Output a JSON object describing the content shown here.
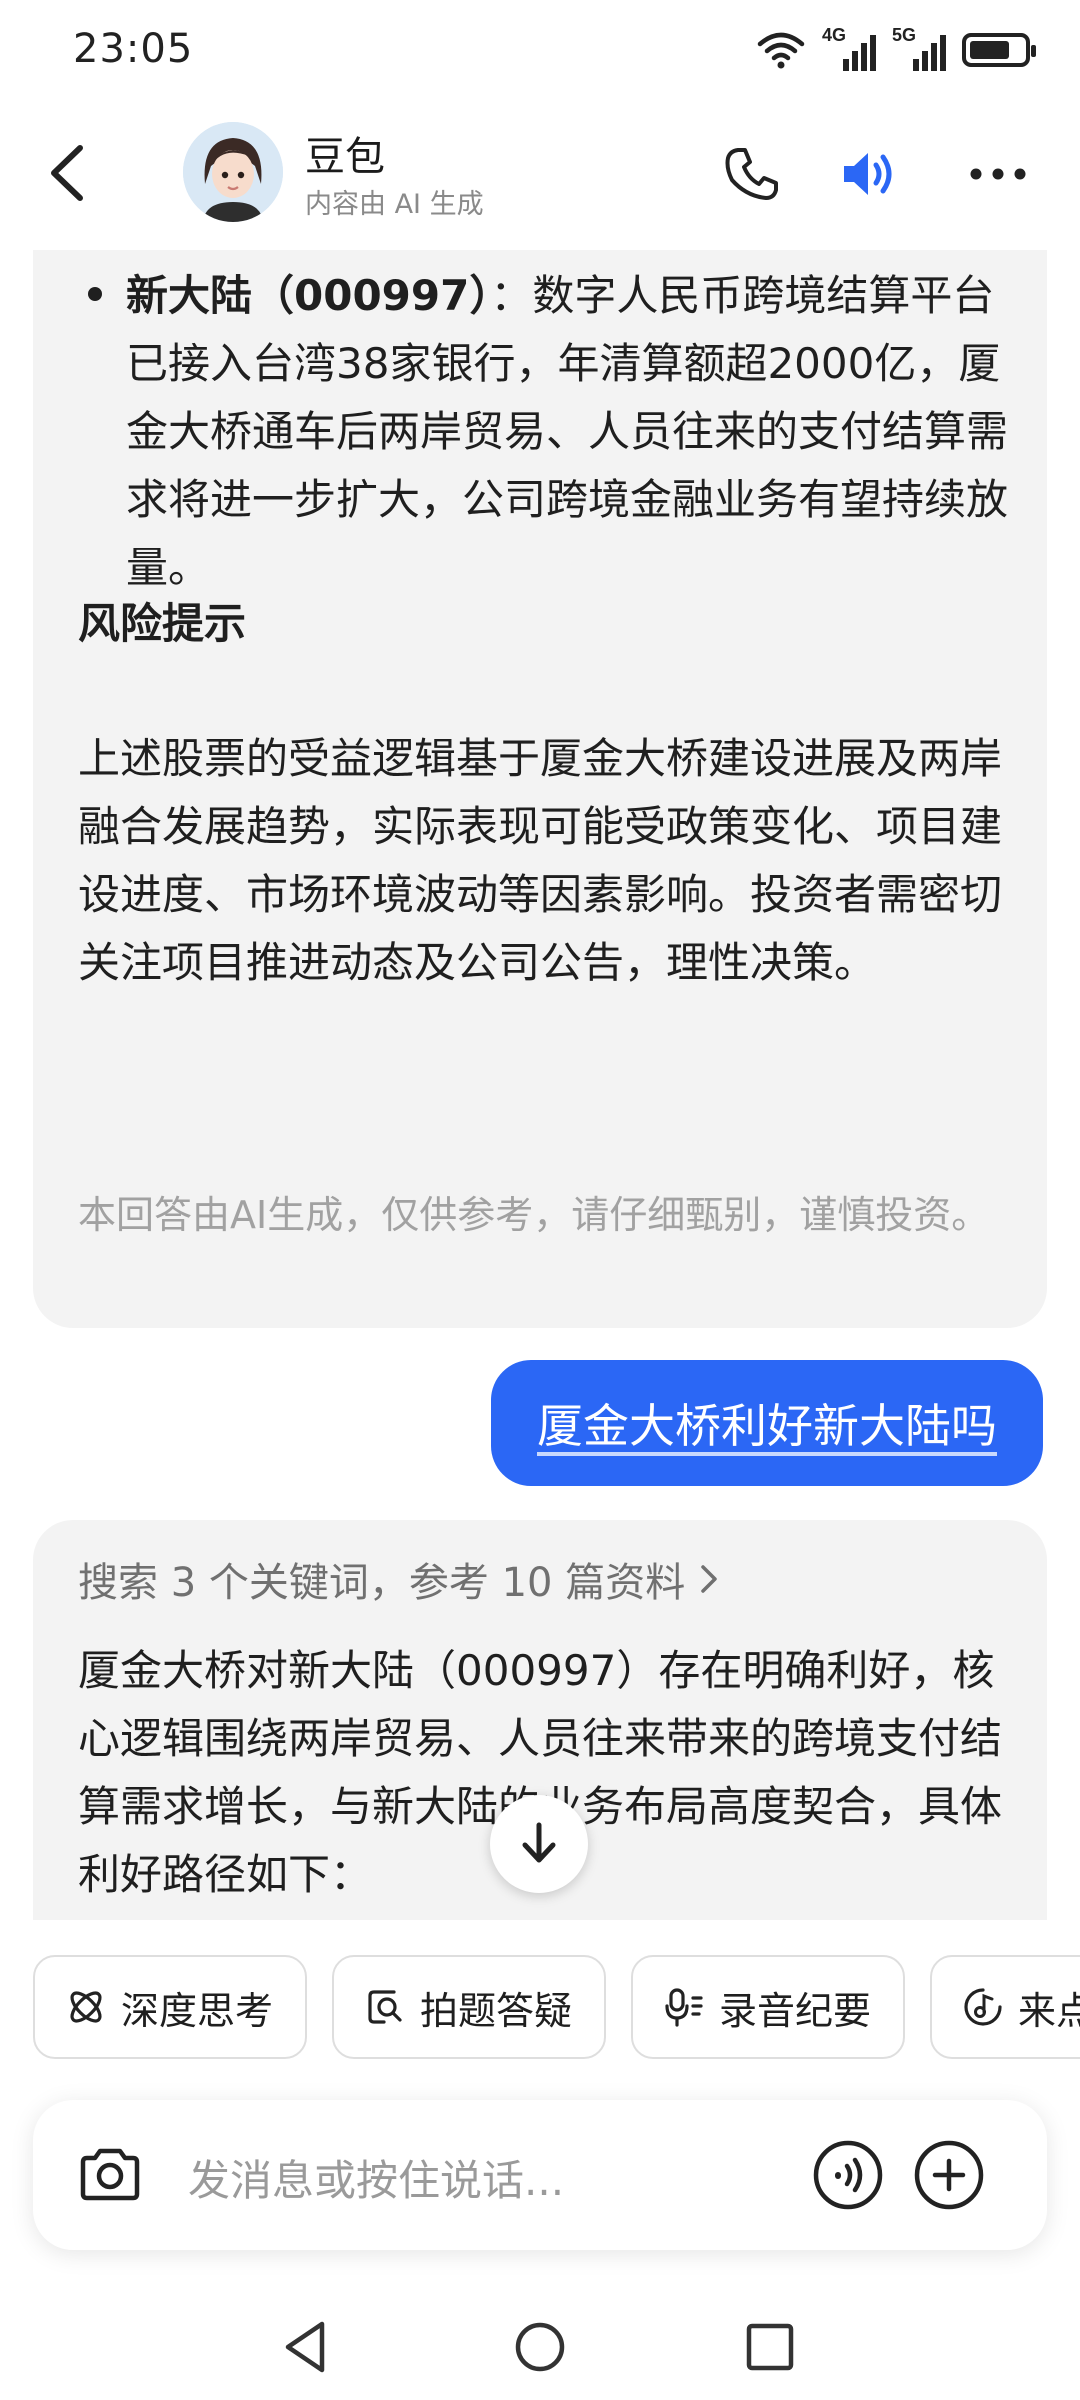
{
  "status_bar": {
    "time": "23:05",
    "network_1": "4G",
    "network_2": "5G",
    "battery_level": 0.75
  },
  "header": {
    "title": "豆包",
    "subtitle": "内容由 AI 生成"
  },
  "messages": {
    "ai_1": {
      "bullet_company": "新大陆（000997）",
      "bullet_body": "：数字人民币跨境结算平台已接入台湾38家银行，年清算额超2000亿，厦金大桥通车后两岸贸易、人员往来的支付结算需求将进一步扩大，公司跨境金融业务有望持续放量。",
      "risk_heading": "风险提示",
      "risk_body": "上述股票的受益逻辑基于厦金大桥建设进展及两岸融合发展趋势，实际表现可能受政策变化、项目建设进度、市场环境波动等因素影响。投资者需密切关注项目推进动态及公司公告，理性决策。",
      "disclaimer": "本回答由AI生成，仅供参考，请仔细甄别，谨慎投资。"
    },
    "user_1": "厦金大桥利好新大陆吗",
    "ai_2": {
      "search_summary": "搜索 3 个关键词，参考 10 篇资料",
      "body": "厦金大桥对新大陆（000997）存在明确利好，核心逻辑围绕两岸贸易、人员往来带来的跨境支付结算需求增长，与新大陆的业务布局高度契合，具体利好路径如下："
    }
  },
  "quick_actions": [
    {
      "label": "深度思考",
      "icon": "atom-icon"
    },
    {
      "label": "拍题答疑",
      "icon": "photo-search-icon"
    },
    {
      "label": "录音纪要",
      "icon": "microphone-icon"
    },
    {
      "label": "来点",
      "icon": "music-note-icon"
    }
  ],
  "input": {
    "placeholder": "发消息或按住说话..."
  },
  "colors": {
    "accent": "#2b67f5",
    "ai_bubble": "#f3f3f3",
    "muted_text": "#a1a1a1"
  }
}
